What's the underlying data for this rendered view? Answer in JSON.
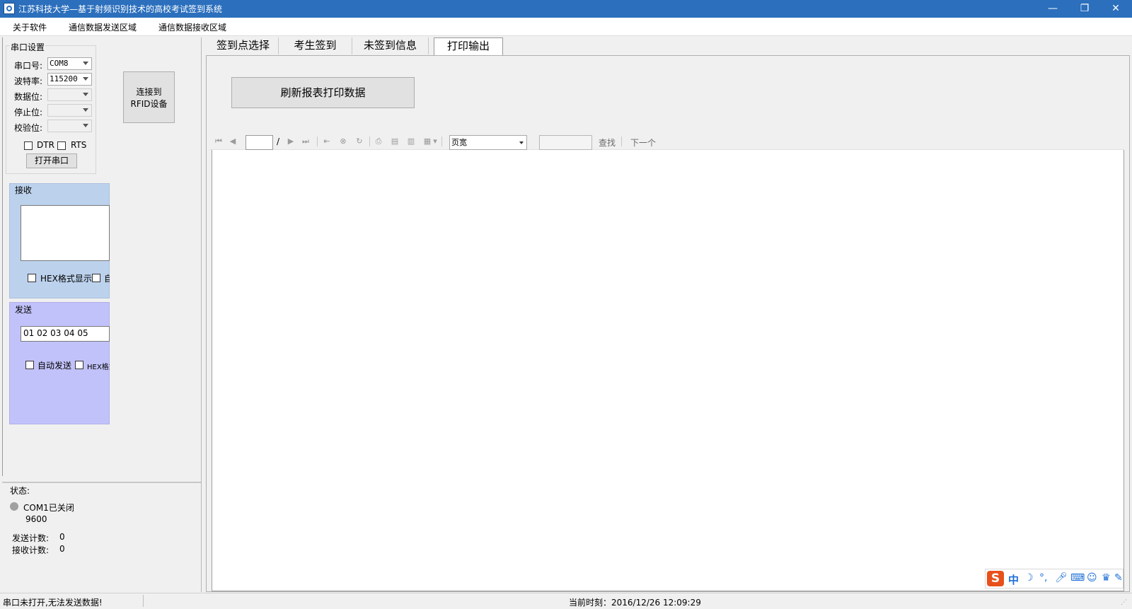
{
  "window": {
    "title": "江苏科技大学—基于射频识别技术的高校考试签到系统",
    "controls": {
      "minimize": "—",
      "maximize": "❐",
      "close": "✕"
    }
  },
  "menu": [
    "关于软件",
    "通信数据发送区域",
    "通信数据接收区域"
  ],
  "serial": {
    "group_title": "串口设置",
    "port_label": "串口号:",
    "port_value": "COM8",
    "baud_label": "波特率:",
    "baud_value": "115200",
    "databits_label": "数据位:",
    "stopbits_label": "停止位:",
    "parity_label": "校验位:",
    "dtr_label": "DTR",
    "rts_label": "RTS",
    "open_button": "打开串口",
    "connect_button_line1": "连接到",
    "connect_button_line2": "RFID设备"
  },
  "receive": {
    "title": "接收",
    "hex_display": "HEX格式显示",
    "truncated_option": "自"
  },
  "send": {
    "title": "发送",
    "input_value": "01 02 03 04 05",
    "auto_send": "自动发送",
    "hex_send": "HEX格式"
  },
  "status": {
    "title": "状态:",
    "port_state": "COM1已关闭",
    "baud": "9600",
    "sent_count_label": "发送计数:",
    "sent_count": "0",
    "recv_count_label": "接收计数:",
    "recv_count": "0"
  },
  "tabs": [
    {
      "label": "签到点选择",
      "active": false
    },
    {
      "label": "考生签到",
      "active": false
    },
    {
      "label": "未签到信息",
      "active": false
    },
    {
      "label": "打印输出",
      "active": true
    }
  ],
  "print": {
    "refresh_button": "刷新报表打印数据",
    "page_separator": "/",
    "zoom_value": "页宽",
    "find_label": "查找",
    "next_label": "下一个"
  },
  "statusbar": {
    "message": "串口未打开,无法发送数据!",
    "time": "当前时刻：2016/12/26 12:09:29"
  },
  "ime": {
    "logo": "S",
    "mode": "中"
  },
  "colors": {
    "titlebar": "#2b6fbd",
    "receive_panel": "#bcd1ec",
    "send_panel": "#c2c2fa",
    "status_dot": "#a0a0a0",
    "ime_logo": "#e8501a"
  }
}
